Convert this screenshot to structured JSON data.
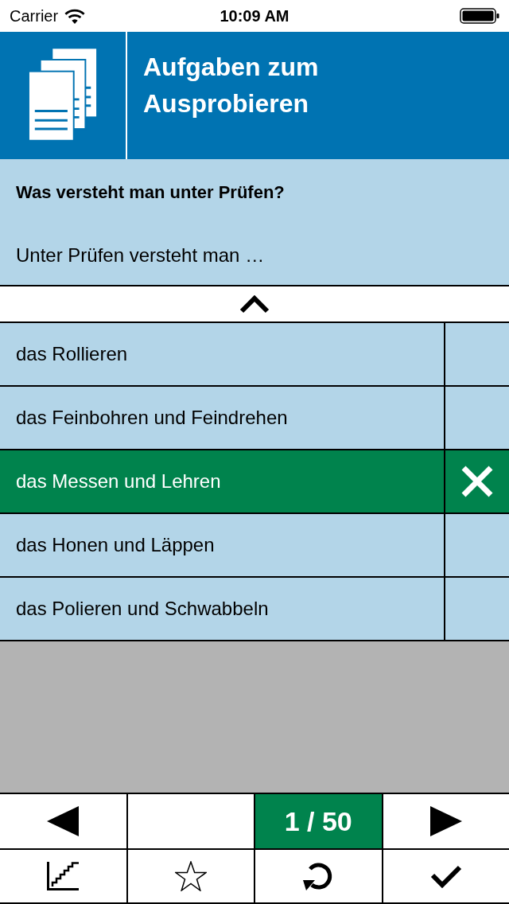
{
  "status_bar": {
    "carrier": "Carrier",
    "time": "10:09 AM"
  },
  "header": {
    "title": "Aufgaben zum Ausprobieren"
  },
  "question": {
    "title": "Was versteht man unter Prüfen?",
    "stem": "Unter Prüfen versteht man …"
  },
  "answers": [
    {
      "text": "das Rollieren",
      "selected": false
    },
    {
      "text": "das Feinbohren und Feindrehen",
      "selected": false
    },
    {
      "text": "das Messen und Lehren",
      "selected": true
    },
    {
      "text": "das Honen und Läppen",
      "selected": false
    },
    {
      "text": "das Polieren und Schwabbeln",
      "selected": false
    }
  ],
  "pager": {
    "counter": "1 / 50"
  },
  "toolbar": {
    "starred": false
  }
}
